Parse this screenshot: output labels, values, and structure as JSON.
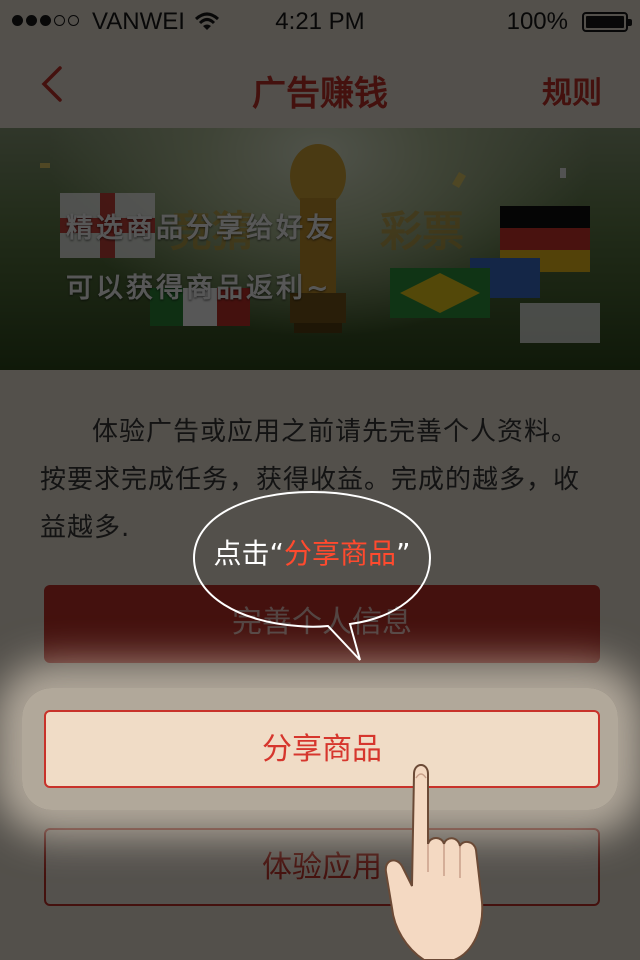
{
  "status_bar": {
    "carrier": "VANWEI",
    "time": "4:21 PM",
    "battery_percent": "100%",
    "signal_bars_filled": 3,
    "signal_bars_total": 5
  },
  "nav": {
    "back_icon": "chevron-left-icon",
    "title": "广告赚钱",
    "rules_label": "规则"
  },
  "banner": {
    "line1": "精选商品分享给好友",
    "line2": "可以获得商品返利~"
  },
  "intro_text": "体验广告或应用之前请先完善个人资料。按要求完成任务，获得收益。完成的越多，收益越多.",
  "buttons": {
    "complete_profile": "完善个人信息",
    "share_products": "分享商品",
    "experience_apps": "体验应用"
  },
  "guide": {
    "prefix": "点击“",
    "highlight": "分享商品",
    "suffix": "”"
  },
  "colors": {
    "accent": "#c8322a",
    "background": "#f3eadd",
    "overlay": "rgba(0,0,0,0.66)",
    "guide_highlight": "#ff4a2e"
  }
}
